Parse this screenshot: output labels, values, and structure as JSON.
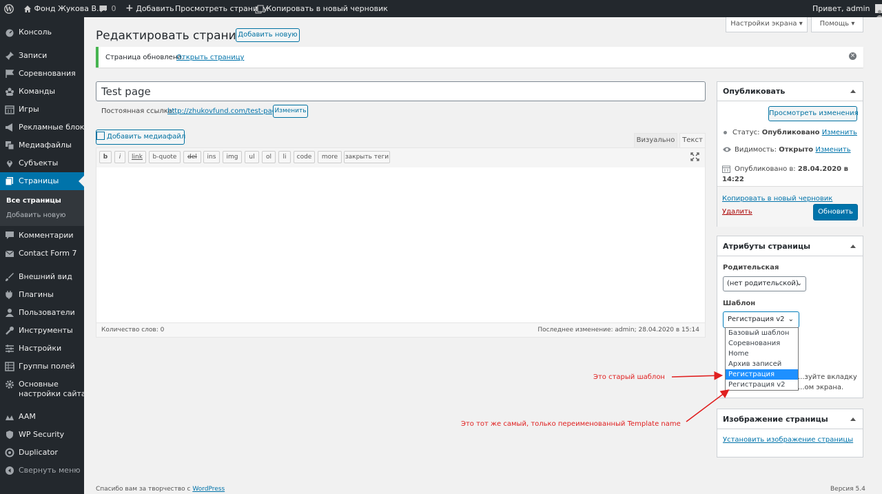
{
  "admin_bar": {
    "site_name": "Фонд Жукова В.В.",
    "comments_count": "0",
    "new_label": "Добавить",
    "view_page": "Просмотреть страницу",
    "copy_draft": "Копировать в новый черновик",
    "greeting": "Привет, admin"
  },
  "sidebar": {
    "items": [
      {
        "label": "Консоль",
        "icon": "dashboard-icon"
      },
      {
        "label": "Записи",
        "icon": "pin-icon"
      },
      {
        "label": "Соревнования",
        "icon": "flag-icon"
      },
      {
        "label": "Команды",
        "icon": "group-icon"
      },
      {
        "label": "Игры",
        "icon": "calendar-icon"
      },
      {
        "label": "Рекламные блоки",
        "icon": "megaphone-icon"
      },
      {
        "label": "Медиафайлы",
        "icon": "media-icon"
      },
      {
        "label": "Субъекты",
        "icon": "location-icon"
      },
      {
        "label": "Страницы",
        "icon": "pages-icon"
      },
      {
        "label": "Комментарии",
        "icon": "comment-icon"
      },
      {
        "label": "Contact Form 7",
        "icon": "mail-icon"
      },
      {
        "label": "Внешний вид",
        "icon": "brush-icon"
      },
      {
        "label": "Плагины",
        "icon": "plugin-icon"
      },
      {
        "label": "Пользователи",
        "icon": "user-icon"
      },
      {
        "label": "Инструменты",
        "icon": "wrench-icon"
      },
      {
        "label": "Настройки",
        "icon": "settings-icon"
      },
      {
        "label": "Группы полей",
        "icon": "table-icon"
      },
      {
        "label": "Основные",
        "label2": "настройки сайта",
        "icon": "gear-icon"
      },
      {
        "label": "AAM",
        "icon": "aam-icon"
      },
      {
        "label": "WP Security",
        "icon": "shield-icon"
      },
      {
        "label": "Duplicator",
        "icon": "duplicator-icon"
      },
      {
        "label": "Свернуть меню",
        "icon": "collapse-icon"
      }
    ],
    "submenu": [
      "Все страницы",
      "Добавить новую"
    ]
  },
  "top_tabs": {
    "screen_options": "Настройки экрана",
    "help": "Помощь"
  },
  "page": {
    "heading": "Редактировать страницу",
    "add_new": "Добавить новую",
    "notice": "Страница обновлена.",
    "notice_link": "Открыть страницу",
    "title_value": "Test page",
    "permalink_label": "Постоянная ссылка:",
    "permalink_url": "http://zhukovfund.com/test-page/",
    "permalink_edit": "Изменить",
    "add_media": "Добавить медиафайл",
    "tab_visual": "Визуально",
    "tab_text": "Текст",
    "quicktags": [
      "b",
      "i",
      "link",
      "b-quote",
      "del",
      "ins",
      "img",
      "ul",
      "ol",
      "li",
      "code",
      "more",
      "закрыть теги"
    ],
    "word_count": "Количество слов: 0",
    "last_edit": "Последнее изменение: admin; 28.04.2020 в 15:14",
    "footer_thanks": "Спасибо вам за творчество с",
    "footer_wp": "WordPress",
    "footer_version": "Версия 5.4"
  },
  "publish": {
    "title": "Опубликовать",
    "preview_changes": "Просмотреть изменения",
    "status_label": "Статус:",
    "status_value": "Опубликовано",
    "visibility_label": "Видимость:",
    "visibility_value": "Открыто",
    "published_label": "Опубликовано в:",
    "published_value": "28.04.2020 в 14:22",
    "edit": "Изменить",
    "copy_draft": "Копировать в новый черновик",
    "delete": "Удалить",
    "update": "Обновить"
  },
  "attributes": {
    "title": "Атрибуты страницы",
    "parent_label": "Родительская",
    "parent_value": "(нет родительской)",
    "template_label": "Шаблон",
    "template_value": "Регистрация v2",
    "template_options": [
      "Базовый шаблон",
      "Соревнования",
      "Home",
      "Архив записей",
      "Регистрация",
      "Регистрация v2"
    ],
    "help_text_1": "...зуйте вкладку",
    "help_text_2": "...ом экрана."
  },
  "featured": {
    "title": "Изображение страницы",
    "set_link": "Установить изображение страницы"
  },
  "annotations": {
    "old_template": "Это старый шаблон",
    "renamed_template": "Это тот же самый, только переименованный Template name",
    "color": "#e02020"
  },
  "colors": {
    "accent": "#0073aa",
    "admin_bar": "#23282d",
    "notice": "#46b450"
  }
}
